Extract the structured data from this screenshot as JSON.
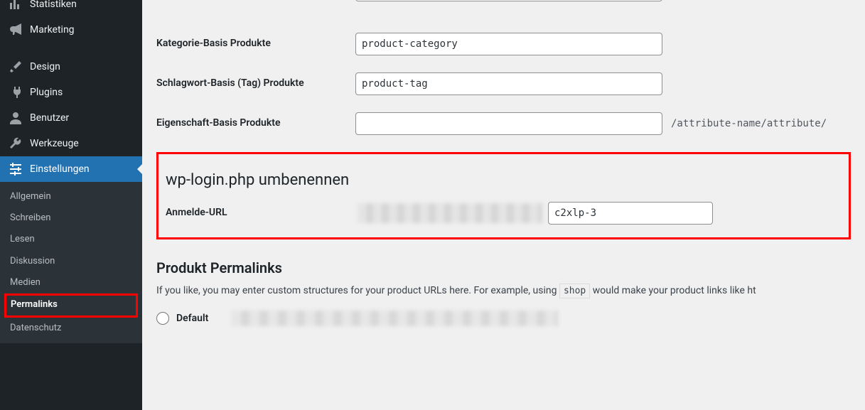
{
  "sidebar": {
    "top": [
      {
        "label": "Statistiken",
        "icon": "stats"
      },
      {
        "label": "Marketing",
        "icon": "megaphone"
      }
    ],
    "middle": [
      {
        "label": "Design",
        "icon": "brush"
      },
      {
        "label": "Plugins",
        "icon": "plug"
      },
      {
        "label": "Benutzer",
        "icon": "user"
      },
      {
        "label": "Werkzeuge",
        "icon": "wrench"
      },
      {
        "label": "Einstellungen",
        "icon": "sliders",
        "current": true
      }
    ],
    "sub": [
      {
        "label": "Allgemein"
      },
      {
        "label": "Schreiben"
      },
      {
        "label": "Lesen"
      },
      {
        "label": "Diskussion"
      },
      {
        "label": "Medien"
      },
      {
        "label": "Permalinks",
        "current": true
      },
      {
        "label": "Datenschutz"
      }
    ]
  },
  "fields": {
    "category_label": "Kategorie-Basis Produkte",
    "category_value": "product-category",
    "tag_label": "Schlagwort-Basis (Tag) Produkte",
    "tag_value": "product-tag",
    "attr_label": "Eigenschaft-Basis Produkte",
    "attr_value": "",
    "attr_hint": "/attribute-name/attribute/"
  },
  "rename": {
    "title": "wp-login.php umbenennen",
    "label": "Anmelde-URL",
    "value": "c2xlp-3"
  },
  "product_permalinks": {
    "title": "Produkt Permalinks",
    "desc_prefix": "If you like, you may enter custom structures for your product URLs here. For example, using ",
    "desc_code": "shop",
    "desc_suffix": " would make your product links like  ht",
    "option_default": "Default"
  }
}
